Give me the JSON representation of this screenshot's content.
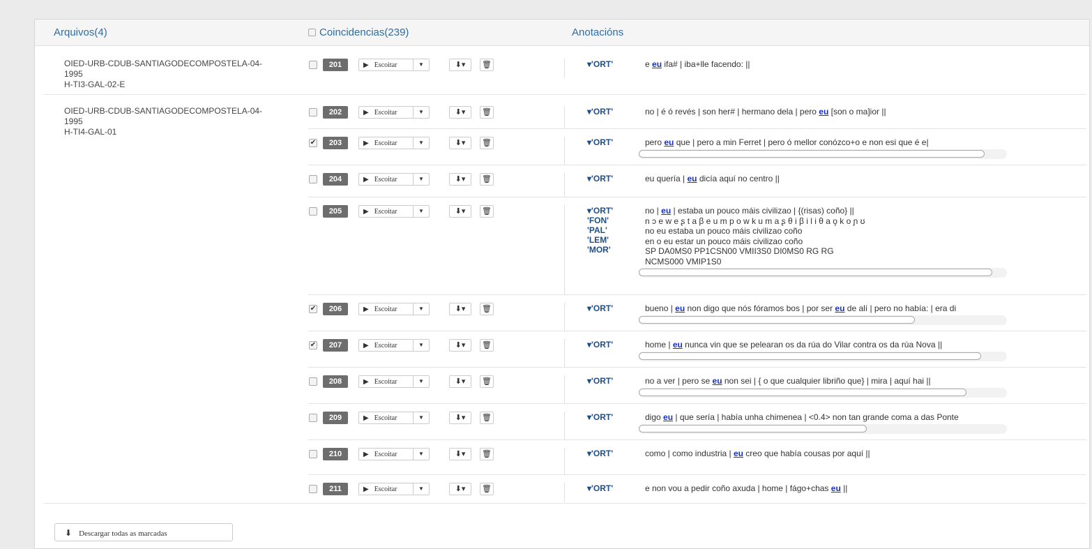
{
  "header": {
    "files_label": "Arquivos(4)",
    "matches_label": "Coincidencias(239)",
    "annotations_label": "Anotacións"
  },
  "files": [
    {
      "line1": "OIED-URB-CDUB-SANTIAGODECOMPOSTELA-04-",
      "line2": "1995",
      "line3": "H-TI3-GAL-02-E"
    },
    {
      "line1": "OIED-URB-CDUB-SANTIAGODECOMPOSTELA-04-",
      "line2": "1995",
      "line3": "H-TI4-GAL-01"
    }
  ],
  "listen_label": "Escoitar",
  "ort_tag": "ORT",
  "rows": [
    {
      "num": "201",
      "checked": false,
      "tags": [
        "'ORT'"
      ],
      "pre": "e ",
      "eu": "eu",
      "post": " ifa# | iba+lle facendo: ||"
    },
    {
      "num": "202",
      "checked": false,
      "tags": [
        "'ORT'"
      ],
      "pre": "no | é ó revés | son her# | hermano dela | pero ",
      "eu": "eu",
      "post": " [son o ma]ior ||"
    },
    {
      "num": "203",
      "checked": true,
      "tags": [
        "'ORT'"
      ],
      "pre": "pero ",
      "eu": "eu",
      "post": " que | pero a min Ferret | pero ó mellor conózco+o e non esi que é e|",
      "scroll": 0.94
    },
    {
      "num": "204",
      "checked": false,
      "tags": [
        "'ORT'"
      ],
      "pre": "eu quería | ",
      "eu": "eu",
      "post": " dicía aquí no centro ||"
    },
    {
      "num": "205",
      "checked": false,
      "tags": [
        "'ORT'",
        "'FON'",
        "'PAL'",
        "'LEM'",
        "'MOR'"
      ],
      "pre": "no | ",
      "eu": "eu",
      "post": " | estaba un pouco máis civilizao | {(risas) coño} ||",
      "extra": [
        "n ɔ e w e ʂ t a β e u m p o w k u m a ʂ θ i β i l i θ a o̧ k o ɲ ʊ",
        "no eu estaba un pouco máis civilizao coño",
        "en o eu estar un pouco máis civilizao coño",
        "SP DA0MS0 PP1CSN00 VMII3S0 DI0MS0 RG RG",
        "NCMS000 VMIP1S0"
      ],
      "scroll": 0.96
    },
    {
      "num": "206",
      "checked": true,
      "tags": [
        "'ORT'"
      ],
      "pre": "bueno | ",
      "eu": "eu",
      "post": " non digo que nós fóramos bos | por ser ",
      "eu2": "eu",
      "post2": " de alí | pero no había: | era di",
      "scroll": 0.75
    },
    {
      "num": "207",
      "checked": true,
      "tags": [
        "'ORT'"
      ],
      "pre": "home | ",
      "eu": "eu",
      "post": " nunca vin que se pelearan os da rúa do Vilar contra os da rúa Nova ||",
      "scroll": 0.93
    },
    {
      "num": "208",
      "checked": false,
      "tags": [
        "'ORT'"
      ],
      "pre": "no a ver | pero se ",
      "eu": "eu",
      "post": " non sei | { o que cualquier libriño que} | mira | aquí hai ||",
      "scroll": 0.89
    },
    {
      "num": "209",
      "checked": false,
      "tags": [
        "'ORT'"
      ],
      "pre": "digo ",
      "eu": "eu",
      "post": " | que sería | había unha chimenea | <0.4> non tan grande coma a das Ponte",
      "scroll": 0.62
    },
    {
      "num": "210",
      "checked": false,
      "tags": [
        "'ORT'"
      ],
      "pre": "como | como industria | ",
      "eu": "eu",
      "post": " creo que había cousas por aquí ||"
    },
    {
      "num": "211",
      "checked": false,
      "tags": [
        "'ORT'"
      ],
      "pre": "e non vou a pedir coño axuda | home | fágo+chas ",
      "eu": "eu",
      "post": " ||"
    }
  ],
  "footer": {
    "download_all_label": "Descargar todas as marcadas"
  }
}
